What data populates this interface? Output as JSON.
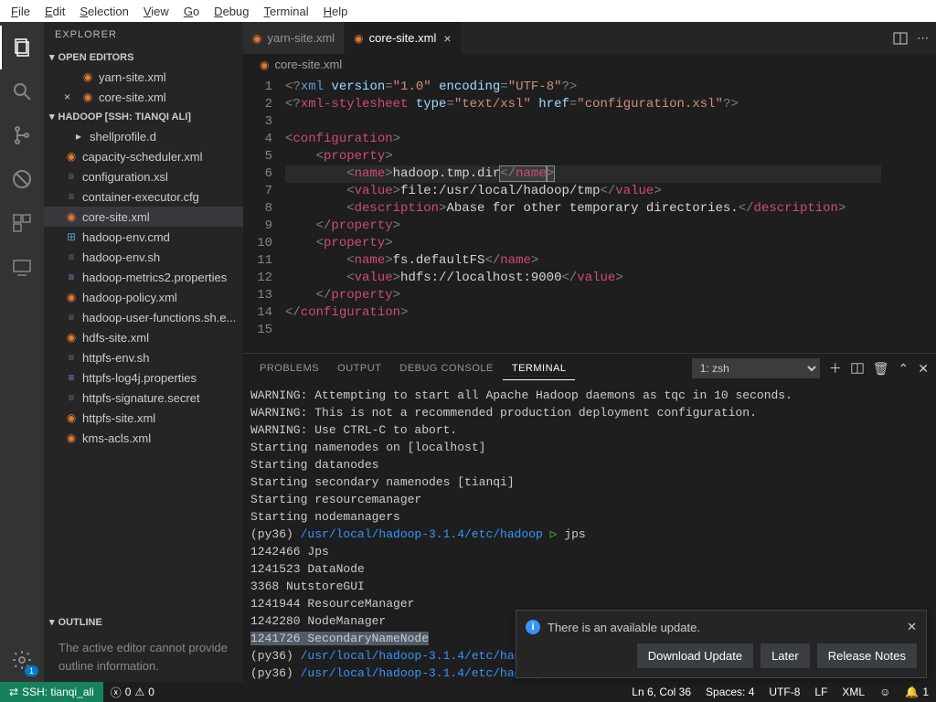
{
  "menubar": [
    "File",
    "Edit",
    "Selection",
    "View",
    "Go",
    "Debug",
    "Terminal",
    "Help"
  ],
  "sidebar": {
    "title": "EXPLORER",
    "sections": {
      "open_editors": "OPEN EDITORS",
      "workspace": "HADOOP [SSH: TIANQI ALI]",
      "outline": "OUTLINE"
    },
    "open_editors": [
      {
        "name": "yarn-site.xml",
        "icon": "rss"
      },
      {
        "name": "core-site.xml",
        "icon": "rss",
        "close": true
      }
    ],
    "files": [
      {
        "name": "shellprofile.d",
        "icon": "folder",
        "indent": true
      },
      {
        "name": "capacity-scheduler.xml",
        "icon": "rss"
      },
      {
        "name": "configuration.xsl",
        "icon": "xml"
      },
      {
        "name": "container-executor.cfg",
        "icon": "xml"
      },
      {
        "name": "core-site.xml",
        "icon": "rss",
        "selected": true
      },
      {
        "name": "hadoop-env.cmd",
        "icon": "win"
      },
      {
        "name": "hadoop-env.sh",
        "icon": "sh"
      },
      {
        "name": "hadoop-metrics2.properties",
        "icon": "prop"
      },
      {
        "name": "hadoop-policy.xml",
        "icon": "rss"
      },
      {
        "name": "hadoop-user-functions.sh.e...",
        "icon": "sh"
      },
      {
        "name": "hdfs-site.xml",
        "icon": "rss"
      },
      {
        "name": "httpfs-env.sh",
        "icon": "sh"
      },
      {
        "name": "httpfs-log4j.properties",
        "icon": "prop"
      },
      {
        "name": "httpfs-signature.secret",
        "icon": "xml"
      },
      {
        "name": "httpfs-site.xml",
        "icon": "rss"
      },
      {
        "name": "kms-acls.xml",
        "icon": "rss"
      }
    ],
    "outline_msg": "The active editor cannot provide outline information."
  },
  "tabs": [
    {
      "name": "yarn-site.xml",
      "icon": "rss"
    },
    {
      "name": "core-site.xml",
      "icon": "rss",
      "active": true,
      "close": true
    }
  ],
  "breadcrumb": {
    "icon": "rss",
    "text": "core-site.xml"
  },
  "editor": {
    "lines": 15,
    "cursor_line": 6
  },
  "panel": {
    "tabs": [
      "PROBLEMS",
      "OUTPUT",
      "DEBUG CONSOLE",
      "TERMINAL"
    ],
    "active_tab": "TERMINAL",
    "terminal_select": "1: zsh"
  },
  "terminal_lines": [
    {
      "t": "WARNING: Attempting to start all Apache Hadoop daemons as tqc in 10 seconds."
    },
    {
      "t": "WARNING: This is not a recommended production deployment configuration."
    },
    {
      "t": "WARNING: Use CTRL-C to abort."
    },
    {
      "t": "Starting namenodes on [localhost]"
    },
    {
      "t": "Starting datanodes"
    },
    {
      "t": "Starting secondary namenodes [tianqi]"
    },
    {
      "t": "Starting resourcemanager"
    },
    {
      "t": "Starting nodemanagers"
    },
    {
      "prompt": true,
      "env": "(py36)",
      "path": "/usr/local/hadoop-3.1.4/etc/hadoop",
      "cmd": "jps"
    },
    {
      "t": "1242466 Jps"
    },
    {
      "t": "1241523 DataNode"
    },
    {
      "t": "3368 NutstoreGUI"
    },
    {
      "t": "1241944 ResourceManager"
    },
    {
      "t": "1242280 NodeManager"
    },
    {
      "t": "1241726 SecondaryNameNode",
      "hl": true
    },
    {
      "prompt": true,
      "env": "(py36)",
      "path": "/usr/local/hadoop-3.1.4/etc/hadoop",
      "cmd": ""
    },
    {
      "prompt": true,
      "env": "(py36)",
      "path": "/usr/local/hadoop-3.1.4/etc/hadoop",
      "cmd": ""
    }
  ],
  "notification": {
    "message": "There is an available update.",
    "buttons": [
      "Download Update",
      "Later",
      "Release Notes"
    ]
  },
  "statusbar": {
    "remote": "SSH: tianqi_ali",
    "errors": "0",
    "warnings": "0",
    "lncol": "Ln 6, Col 36",
    "spaces": "Spaces: 4",
    "encoding": "UTF-8",
    "eol": "LF",
    "lang": "XML",
    "notif": "1"
  }
}
